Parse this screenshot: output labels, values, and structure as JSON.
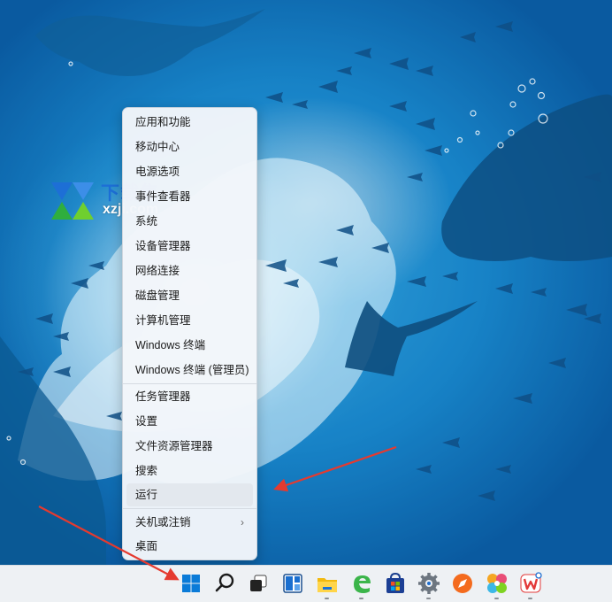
{
  "watermark": {
    "brand_cn": "下载集",
    "brand_url": "xzji.com"
  },
  "context_menu": {
    "items": [
      {
        "label": "应用和功能"
      },
      {
        "label": "移动中心"
      },
      {
        "label": "电源选项"
      },
      {
        "label": "事件查看器"
      },
      {
        "label": "系统"
      },
      {
        "label": "设备管理器"
      },
      {
        "label": "网络连接"
      },
      {
        "label": "磁盘管理"
      },
      {
        "label": "计算机管理"
      },
      {
        "label": "Windows 终端"
      },
      {
        "label": "Windows 终端 (管理员)"
      },
      {
        "label": "任务管理器"
      },
      {
        "label": "设置"
      },
      {
        "label": "文件资源管理器"
      },
      {
        "label": "搜索"
      },
      {
        "label": "运行"
      },
      {
        "label": "关机或注销",
        "submenu_glyph": "›"
      },
      {
        "label": "桌面"
      }
    ],
    "highlighted_item": "运行"
  },
  "taskbar": {
    "icons": [
      "windows-start-icon",
      "search-icon",
      "task-view-icon",
      "widgets-icon",
      "file-explorer-icon",
      "edge-legacy-icon",
      "microsoft-store-icon",
      "settings-gear-icon",
      "browser-compass-icon",
      "photo-app-icon",
      "wps-office-icon"
    ]
  },
  "colors": {
    "accent_blue": "#0067c0",
    "annotation_red": "#e53a2f",
    "menu_bg": "#f3f6fa",
    "taskbar_bg": "#eef1f4"
  }
}
